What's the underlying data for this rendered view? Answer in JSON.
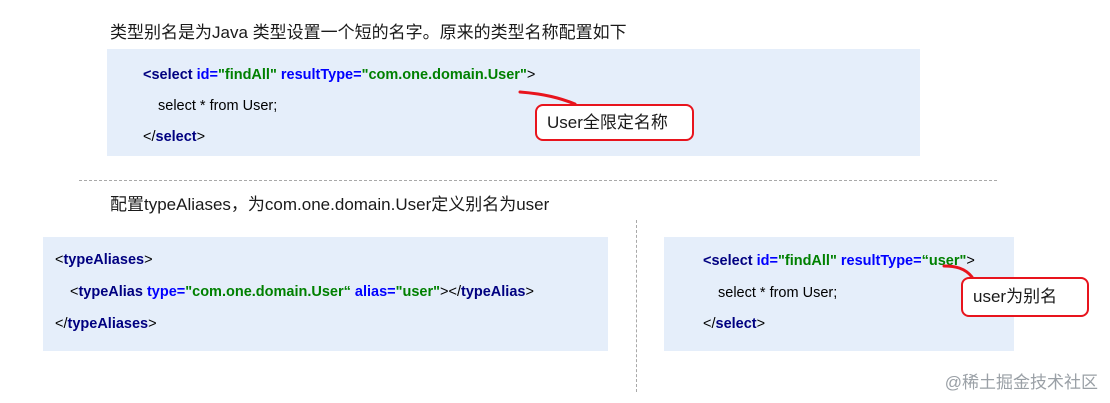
{
  "intro_text": "类型别名是为Java 类型设置一个短的名字。原来的类型名称配置如下",
  "top_code": {
    "line1": {
      "open": "<select ",
      "attr_id": "id=",
      "val_id": "\"findAll\"",
      "attr_rt": " resultType=",
      "val_rt": "\"com.one.domain.User\"",
      "close": ">"
    },
    "line2": "select * from User;",
    "line3_open": "</",
    "line3_tag": "select",
    "line3_close": ">"
  },
  "callout_top": "User全限定名称",
  "config_text": "配置typeAliases，为com.one.domain.User定义别名为user",
  "left_code": {
    "line1_open": "<",
    "line1_tag": "typeAliases",
    "line1_close": ">",
    "line2_open": "<",
    "line2_tag": "typeAlias",
    "line2_attr_type": " type=",
    "line2_val_type": "\"com.one.domain.User“",
    "line2_attr_alias": " alias=",
    "line2_val_alias": "\"user\"",
    "line2_mid": "></",
    "line2_tag_end": "typeAlias",
    "line2_close": ">",
    "line3_open": "</",
    "line3_tag": "typeAliases",
    "line3_close": ">"
  },
  "right_code": {
    "line1": {
      "open": "<select ",
      "attr_id": "id=",
      "val_id": "\"findAll\"",
      "attr_rt": " resultType=",
      "val_rt": "“user\"",
      "close": ">"
    },
    "line2": "select * from User;",
    "line3_open": "</",
    "line3_tag": "select",
    "line3_close": ">"
  },
  "callout_bottom": "user为别名",
  "watermark": "@稀土掘金技术社区",
  "colors": {
    "code_bg": "#e5eefa",
    "tag": "#000080",
    "attr": "#0000ff",
    "value": "#008000",
    "callout_red": "#e8141d"
  }
}
